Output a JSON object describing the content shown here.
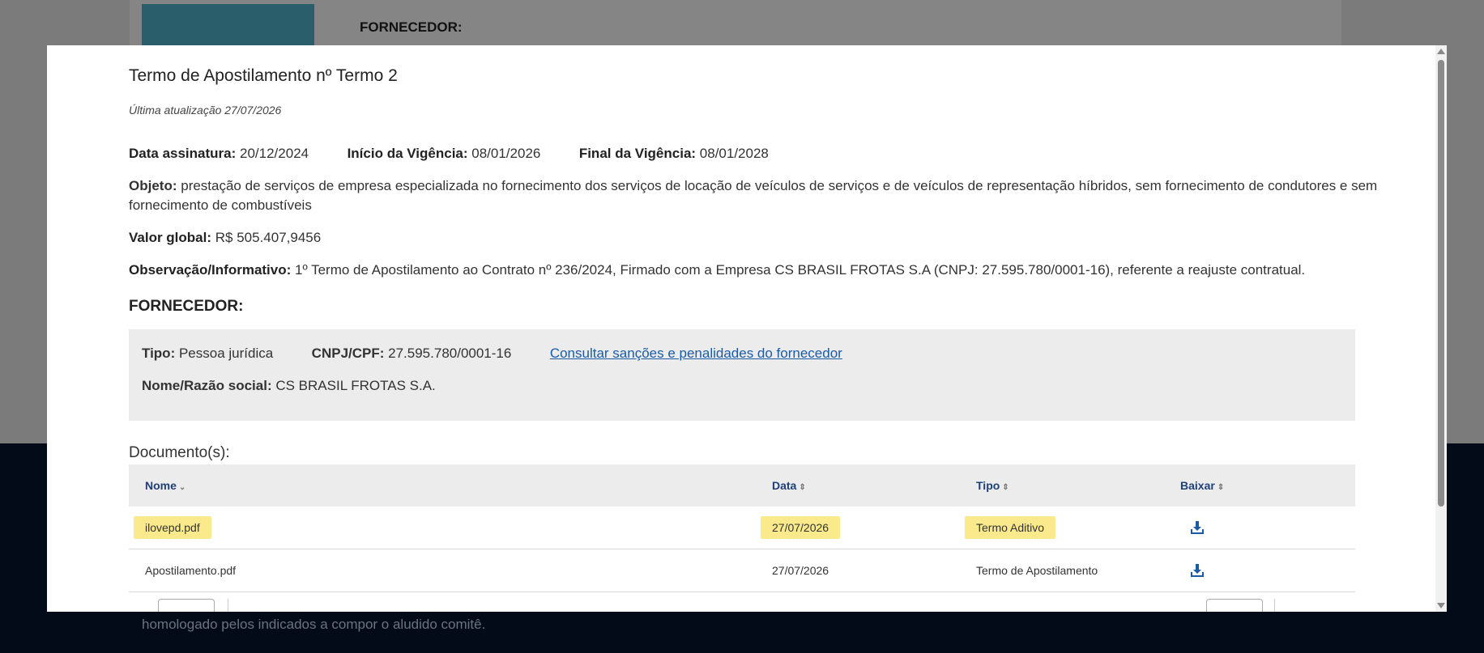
{
  "background": {
    "label": "FORNECEDOR:",
    "text_line1": "homologado pelos indicados a compor o aludido comitê."
  },
  "modal": {
    "title": "Termo de Apostilamento nº Termo 2",
    "updated": "Última atualização 27/07/2026",
    "data_assinatura": {
      "label": "Data assinatura:",
      "value": "20/12/2024"
    },
    "inicio_vigencia": {
      "label": "Início da Vigência:",
      "value": "08/01/2026"
    },
    "final_vigencia": {
      "label": "Final da Vigência:",
      "value": "08/01/2028"
    },
    "objeto": {
      "label": "Objeto:",
      "value": "prestação de serviços de empresa especializada no fornecimento dos serviços de locação de veículos de serviços e de veículos de representação híbridos, sem fornecimento de condutores e sem fornecimento de combustíveis"
    },
    "valor_global": {
      "label": "Valor global:",
      "value": "R$ 505.407,9456"
    },
    "observacao": {
      "label": "Observação/Informativo:",
      "value": "1º Termo de Apostilamento ao Contrato nº 236/2024, Firmado com a Empresa CS BRASIL FROTAS S.A (CNPJ: 27.595.780/0001-16), referente a reajuste contratual."
    },
    "fornecedor_heading": "FORNECEDOR:",
    "fornecedor": {
      "tipo": {
        "label": "Tipo:",
        "value": "Pessoa jurídica"
      },
      "cnpj": {
        "label": "CNPJ/CPF:",
        "value": "27.595.780/0001-16"
      },
      "link": "Consultar sanções e penalidades do fornecedor",
      "nome": {
        "label": "Nome/Razão social:",
        "value": "CS BRASIL FROTAS S.A."
      }
    },
    "documents_heading": "Documento(s):",
    "documents": {
      "headers": {
        "nome": "Nome",
        "data": "Data",
        "tipo": "Tipo",
        "baixar": "Baixar"
      },
      "rows": [
        {
          "nome": "ilovepd.pdf",
          "data": "27/07/2026",
          "tipo": "Termo Aditivo"
        },
        {
          "nome": "Apostilamento.pdf",
          "data": "27/07/2026",
          "tipo": "Termo de Apostilamento"
        }
      ]
    },
    "colors": {
      "highlight": "#fbea8c",
      "link": "#1a5ba6",
      "header_text": "#1f3f75"
    }
  }
}
